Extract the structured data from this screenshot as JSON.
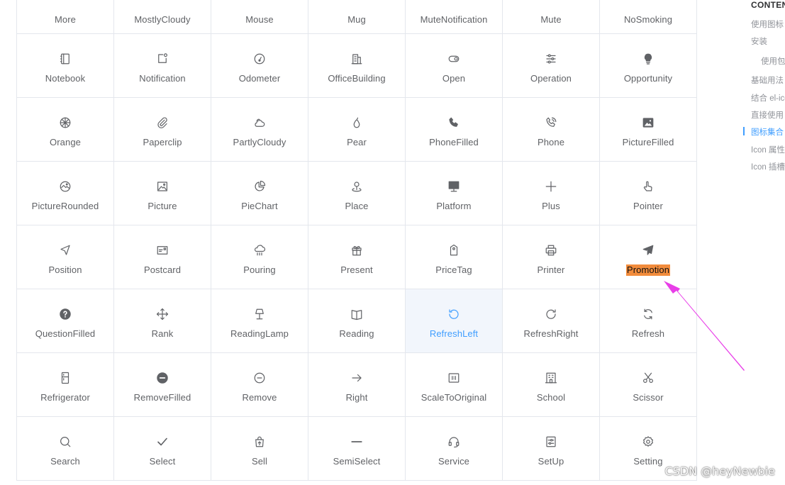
{
  "icon_grid": {
    "cells": [
      {
        "name": "More",
        "icon": ""
      },
      {
        "name": "MostlyCloudy",
        "icon": ""
      },
      {
        "name": "Mouse",
        "icon": ""
      },
      {
        "name": "Mug",
        "icon": ""
      },
      {
        "name": "MuteNotification",
        "icon": ""
      },
      {
        "name": "Mute",
        "icon": ""
      },
      {
        "name": "NoSmoking",
        "icon": ""
      },
      {
        "name": "Notebook",
        "icon": "notebook-icon"
      },
      {
        "name": "Notification",
        "icon": "notification-icon"
      },
      {
        "name": "Odometer",
        "icon": "odometer-icon"
      },
      {
        "name": "OfficeBuilding",
        "icon": "office-building-icon"
      },
      {
        "name": "Open",
        "icon": "open-icon"
      },
      {
        "name": "Operation",
        "icon": "operation-icon"
      },
      {
        "name": "Opportunity",
        "icon": "opportunity-icon"
      },
      {
        "name": "Orange",
        "icon": "orange-icon"
      },
      {
        "name": "Paperclip",
        "icon": "paperclip-icon"
      },
      {
        "name": "PartlyCloudy",
        "icon": "partly-cloudy-icon"
      },
      {
        "name": "Pear",
        "icon": "pear-icon"
      },
      {
        "name": "PhoneFilled",
        "icon": "phone-filled-icon"
      },
      {
        "name": "Phone",
        "icon": "phone-icon"
      },
      {
        "name": "PictureFilled",
        "icon": "picture-filled-icon"
      },
      {
        "name": "PictureRounded",
        "icon": "picture-rounded-icon"
      },
      {
        "name": "Picture",
        "icon": "picture-icon"
      },
      {
        "name": "PieChart",
        "icon": "pie-chart-icon"
      },
      {
        "name": "Place",
        "icon": "place-icon"
      },
      {
        "name": "Platform",
        "icon": "platform-icon"
      },
      {
        "name": "Plus",
        "icon": "plus-icon"
      },
      {
        "name": "Pointer",
        "icon": "pointer-icon"
      },
      {
        "name": "Position",
        "icon": "position-icon"
      },
      {
        "name": "Postcard",
        "icon": "postcard-icon"
      },
      {
        "name": "Pouring",
        "icon": "pouring-icon"
      },
      {
        "name": "Present",
        "icon": "present-icon"
      },
      {
        "name": "PriceTag",
        "icon": "price-tag-icon"
      },
      {
        "name": "Printer",
        "icon": "printer-icon"
      },
      {
        "name": "Promotion",
        "icon": "promotion-icon"
      },
      {
        "name": "QuestionFilled",
        "icon": "question-filled-icon"
      },
      {
        "name": "Rank",
        "icon": "rank-icon"
      },
      {
        "name": "ReadingLamp",
        "icon": "reading-lamp-icon"
      },
      {
        "name": "Reading",
        "icon": "reading-icon"
      },
      {
        "name": "RefreshLeft",
        "icon": "refresh-left-icon"
      },
      {
        "name": "RefreshRight",
        "icon": "refresh-right-icon"
      },
      {
        "name": "Refresh",
        "icon": "refresh-icon"
      },
      {
        "name": "Refrigerator",
        "icon": "refrigerator-icon"
      },
      {
        "name": "RemoveFilled",
        "icon": "remove-filled-icon"
      },
      {
        "name": "Remove",
        "icon": "remove-icon"
      },
      {
        "name": "Right",
        "icon": "right-arrow-icon"
      },
      {
        "name": "ScaleToOriginal",
        "icon": "scale-to-original-icon"
      },
      {
        "name": "School",
        "icon": "school-icon"
      },
      {
        "name": "Scissor",
        "icon": "scissor-icon"
      },
      {
        "name": "Search",
        "icon": "search-icon"
      },
      {
        "name": "Select",
        "icon": "select-icon"
      },
      {
        "name": "Sell",
        "icon": "sell-icon"
      },
      {
        "name": "SemiSelect",
        "icon": "semi-select-icon"
      },
      {
        "name": "Service",
        "icon": "service-icon"
      },
      {
        "name": "SetUp",
        "icon": "setup-icon"
      },
      {
        "name": "Setting",
        "icon": "setting-icon"
      }
    ],
    "active_cell": "RefreshLeft",
    "highlighted_cell": "Promotion"
  },
  "toc": {
    "title": "CONTENTS",
    "items": [
      {
        "label": "使用图标",
        "indent": false,
        "active": false
      },
      {
        "label": "安装",
        "indent": false,
        "active": false
      },
      {
        "label": "使用包管理器",
        "indent": true,
        "active": false
      },
      {
        "label": "基础用法",
        "indent": false,
        "active": false
      },
      {
        "label": "结合 el-icon 使用",
        "indent": false,
        "active": false
      },
      {
        "label": "直接使用 SVG 图标",
        "indent": false,
        "active": false
      },
      {
        "label": "图标集合",
        "indent": false,
        "active": true
      },
      {
        "label": "Icon 属性",
        "indent": false,
        "active": false
      },
      {
        "label": "Icon 插槽",
        "indent": false,
        "active": false
      }
    ]
  },
  "watermark": "CSDN @heyNewbie",
  "colors": {
    "text": "#606266",
    "border": "#e4e7ed",
    "accent": "#409eff",
    "active_bg": "#f2f6fc",
    "highlight": "#f28c3c",
    "annotation_arrow": "#e83ee8"
  }
}
